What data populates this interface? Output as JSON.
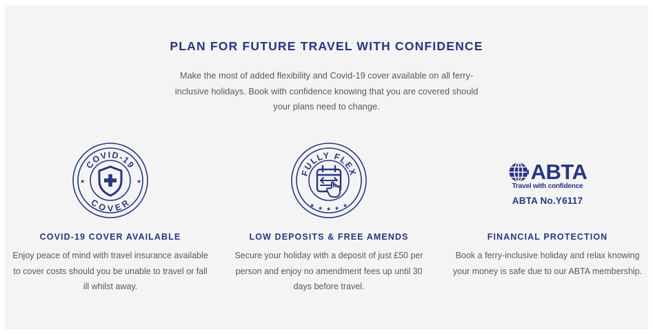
{
  "section": {
    "heading": "PLAN FOR FUTURE TRAVEL WITH CONFIDENCE",
    "intro": "Make the most of added flexibility and Covid-19 cover available on all ferry-inclusive holidays. Book with confidence knowing that you are covered should your plans need to change."
  },
  "features": [
    {
      "badge_top": "COVID-19",
      "badge_bottom": "COVER",
      "icon": "shield-plus-icon",
      "title": "COVID-19 COVER AVAILABLE",
      "description": "Enjoy peace of mind with travel insurance available to cover costs should you be unable to travel or fall ill whilst away."
    },
    {
      "badge_top": "FULLY FLEX",
      "icon": "calendar-arrows-hand-icon",
      "title": "LOW DEPOSITS & FREE AMENDS",
      "description": "Secure your holiday with a deposit of just £50 per person and enjoy no amendment fees up until 30 days before travel."
    },
    {
      "logo_word": "ABTA",
      "logo_tagline": "Travel with confidence",
      "membership_number": "ABTA No.Y6117",
      "icon": "abta-globe-icon",
      "title": "FINANCIAL PROTECTION",
      "description": "Book a ferry-inclusive holiday and relax knowing your money is safe due to our ABTA membership."
    }
  ],
  "colors": {
    "brand_navy": "#28357f",
    "body_text": "#555a60",
    "panel_background": "#f4f4f5"
  }
}
